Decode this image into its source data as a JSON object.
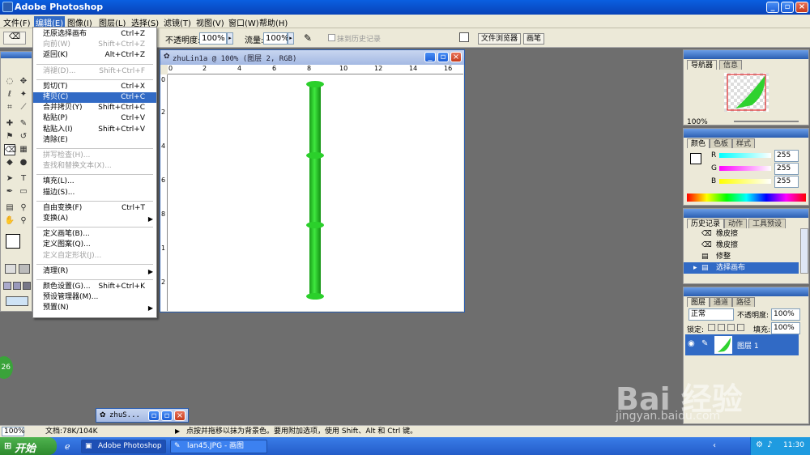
{
  "app": {
    "title": "Adobe Photoshop"
  },
  "menubar": [
    {
      "label": "文件(F)"
    },
    {
      "label": "编辑(E)"
    },
    {
      "label": "图像(I)"
    },
    {
      "label": "图层(L)"
    },
    {
      "label": "选择(S)"
    },
    {
      "label": "滤镜(T)"
    },
    {
      "label": "视图(V)"
    },
    {
      "label": "窗口(W)"
    },
    {
      "label": "帮助(H)"
    }
  ],
  "options": {
    "opacity_label": "不透明度:",
    "opacity_value": "100%",
    "flow_label": "流量:",
    "flow_value": "100%",
    "erase_history_label": "抹到历史记录",
    "file_browser_tab": "文件浏览器",
    "brushes_tab": "画笔"
  },
  "edit_menu": [
    {
      "label": "还原选择画布",
      "shortcut": "Ctrl+Z",
      "state": "normal"
    },
    {
      "label": "向前(W)",
      "shortcut": "Shift+Ctrl+Z",
      "state": "disabled"
    },
    {
      "label": "返回(K)",
      "shortcut": "Alt+Ctrl+Z",
      "state": "normal"
    },
    {
      "sep": true
    },
    {
      "label": "消褪(D)...",
      "shortcut": "Shift+Ctrl+F",
      "state": "disabled"
    },
    {
      "sep": true
    },
    {
      "label": "剪切(T)",
      "shortcut": "Ctrl+X",
      "state": "normal"
    },
    {
      "label": "拷贝(C)",
      "shortcut": "Ctrl+C",
      "state": "selected"
    },
    {
      "label": "合并拷贝(Y)",
      "shortcut": "Shift+Ctrl+C",
      "state": "normal"
    },
    {
      "label": "粘贴(P)",
      "shortcut": "Ctrl+V",
      "state": "normal"
    },
    {
      "label": "粘贴入(I)",
      "shortcut": "Shift+Ctrl+V",
      "state": "normal"
    },
    {
      "label": "清除(E)",
      "shortcut": "",
      "state": "normal"
    },
    {
      "sep": true
    },
    {
      "label": "拼写检查(H)...",
      "shortcut": "",
      "state": "disabled"
    },
    {
      "label": "查找和替换文本(X)...",
      "shortcut": "",
      "state": "disabled"
    },
    {
      "sep": true
    },
    {
      "label": "填充(L)...",
      "shortcut": "",
      "state": "normal"
    },
    {
      "label": "描边(S)...",
      "shortcut": "",
      "state": "normal"
    },
    {
      "sep": true
    },
    {
      "label": "自由变换(F)",
      "shortcut": "Ctrl+T",
      "state": "normal"
    },
    {
      "label": "变换(A)",
      "shortcut": "",
      "state": "submenu"
    },
    {
      "sep": true
    },
    {
      "label": "定义画笔(B)...",
      "shortcut": "",
      "state": "normal"
    },
    {
      "label": "定义图案(Q)...",
      "shortcut": "",
      "state": "normal"
    },
    {
      "label": "定义自定形状(J)...",
      "shortcut": "",
      "state": "disabled"
    },
    {
      "sep": true
    },
    {
      "label": "清理(R)",
      "shortcut": "",
      "state": "submenu"
    },
    {
      "sep": true
    },
    {
      "label": "颜色设置(G)...",
      "shortcut": "Shift+Ctrl+K",
      "state": "normal"
    },
    {
      "label": "预设管理器(M)...",
      "shortcut": "",
      "state": "normal"
    },
    {
      "label": "预置(N)",
      "shortcut": "",
      "state": "submenu"
    }
  ],
  "document": {
    "title": "zhuLin1a @ 100% (图层 2, RGB)",
    "ruler_h": [
      "0",
      "2",
      "4",
      "6",
      "8",
      "10",
      "12",
      "14",
      "16"
    ],
    "ruler_v": [
      "0",
      "2",
      "4",
      "6",
      "8",
      "1",
      "2"
    ]
  },
  "minimized_doc": {
    "title": "zhuS..."
  },
  "navigator": {
    "tabs": [
      "导航器",
      "信息"
    ],
    "zoom": "100%"
  },
  "color": {
    "tabs": [
      "颜色",
      "色板",
      "样式"
    ],
    "channels": [
      {
        "name": "R",
        "value": "255"
      },
      {
        "name": "G",
        "value": "255"
      },
      {
        "name": "B",
        "value": "255"
      }
    ]
  },
  "history": {
    "tabs": [
      "历史记录",
      "动作",
      "工具预设"
    ],
    "items": [
      {
        "label": "橡皮擦",
        "selected": false
      },
      {
        "label": "橡皮擦",
        "selected": false
      },
      {
        "label": "修整",
        "selected": false
      },
      {
        "label": "选择画布",
        "selected": true
      }
    ]
  },
  "layers": {
    "tabs": [
      "图层",
      "通道",
      "路径"
    ],
    "blend_mode": "正常",
    "opacity_label": "不透明度:",
    "opacity_value": "100%",
    "lock_label": "锁定:",
    "fill_label": "填充:",
    "fill_value": "100%",
    "layer_name": "图层 1"
  },
  "statusbar": {
    "zoom": "100%",
    "doc_info": "文档:78K/104K",
    "hint": "点按并拖移以抹为背景色。要用附加选项，使用 Shift、Alt 和 Ctrl 键。"
  },
  "taskbar": {
    "start_label": "开始",
    "tasks": [
      {
        "label": "Adobe Photoshop"
      },
      {
        "label": "lan45.JPG - 画图"
      }
    ],
    "clock": "11:30",
    "badge": "26"
  },
  "watermark": {
    "brand": "Bai 经验",
    "url": "jingyan.baidu.com"
  },
  "colors": {
    "accent": "#316ac5",
    "bamboo": "#22c522",
    "title_blue": "#0842b8"
  }
}
